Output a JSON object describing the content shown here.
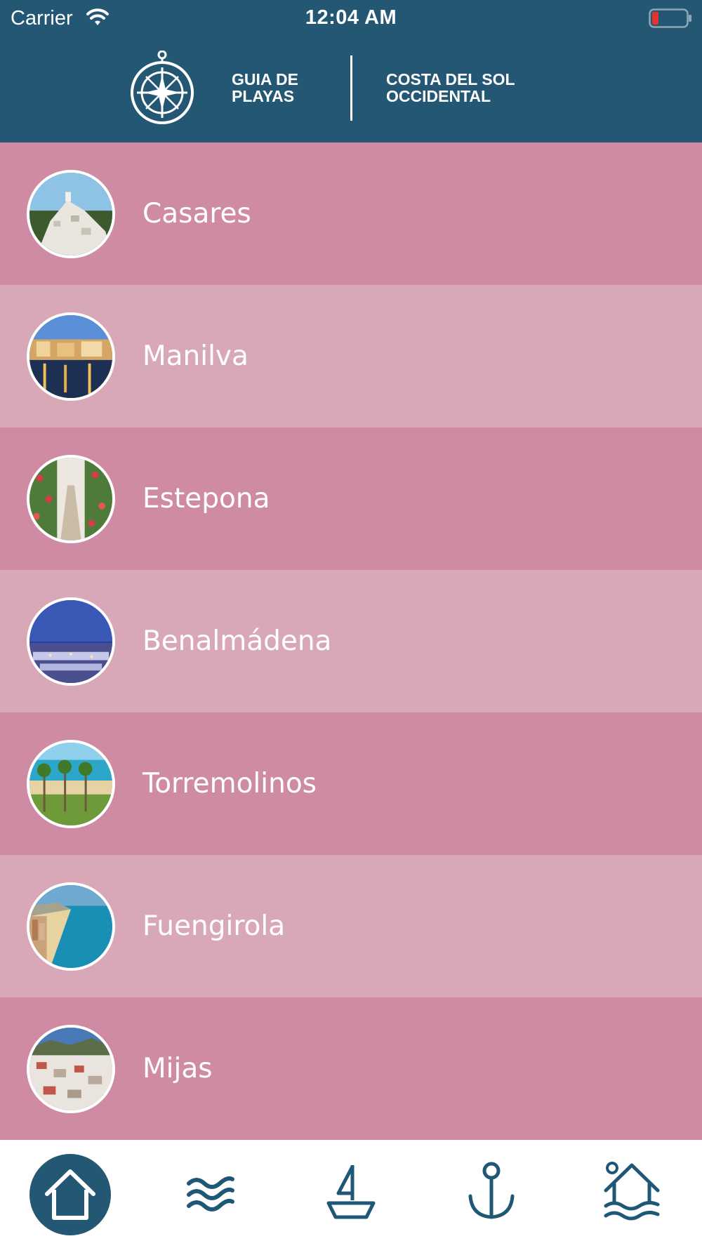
{
  "status_bar": {
    "carrier": "Carrier",
    "time": "12:04 AM"
  },
  "header": {
    "left_title": "GUIA DE\nPLAYAS",
    "right_title": "COSTA DEL SOL\nOCCIDENTAL"
  },
  "towns": [
    {
      "name": "Casares"
    },
    {
      "name": "Manilva"
    },
    {
      "name": "Estepona"
    },
    {
      "name": "Benalmádena"
    },
    {
      "name": "Torremolinos"
    },
    {
      "name": "Fuengirola"
    },
    {
      "name": "Mijas"
    }
  ],
  "tabbar": {
    "tabs": [
      {
        "icon": "home-icon",
        "selected": true
      },
      {
        "icon": "waves-icon",
        "selected": false
      },
      {
        "icon": "sailboat-icon",
        "selected": false
      },
      {
        "icon": "anchor-icon",
        "selected": false
      },
      {
        "icon": "beach-house-icon",
        "selected": false
      }
    ]
  },
  "colors": {
    "header": "#245774",
    "row_dark": "#cf8ba3",
    "row_light": "#d8a8b9",
    "accent": "#245774",
    "battery_low": "#e8322f"
  }
}
